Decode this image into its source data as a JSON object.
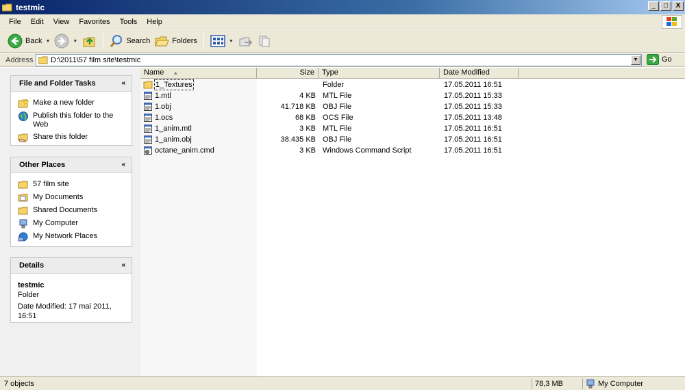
{
  "window": {
    "title": "testmic",
    "min": "_",
    "max": "□",
    "close": "X"
  },
  "menu": [
    "File",
    "Edit",
    "View",
    "Favorites",
    "Tools",
    "Help"
  ],
  "toolbar": {
    "back": "Back",
    "search": "Search",
    "folders": "Folders"
  },
  "address": {
    "label": "Address",
    "path": "D:\\2011\\57 film site\\testmic",
    "go": "Go"
  },
  "tasks": {
    "title": "File and Folder Tasks",
    "items": [
      "Make a new folder",
      "Publish this folder to the Web",
      "Share this folder"
    ]
  },
  "other_places": {
    "title": "Other Places",
    "items": [
      "57 film site",
      "My Documents",
      "Shared Documents",
      "My Computer",
      "My Network Places"
    ]
  },
  "details": {
    "title": "Details",
    "name": "testmic",
    "kind": "Folder",
    "modified": "Date Modified: 17 mai 2011, 16:51"
  },
  "columns": {
    "name": "Name",
    "sort": "▲",
    "size": "Size",
    "type": "Type",
    "date": "Date Modified"
  },
  "files": [
    {
      "name": "1_Textures",
      "size": "",
      "type": "Folder",
      "date": "17.05.2011 16:51",
      "icon": "folder-icon"
    },
    {
      "name": "1.mtl",
      "size": "4 KB",
      "type": "MTL File",
      "date": "17.05.2011 15:33",
      "icon": "file-icon"
    },
    {
      "name": "1.obj",
      "size": "41.718 KB",
      "type": "OBJ File",
      "date": "17.05.2011 15:33",
      "icon": "file-icon"
    },
    {
      "name": "1.ocs",
      "size": "68 KB",
      "type": "OCS File",
      "date": "17.05.2011 13:48",
      "icon": "file-icon"
    },
    {
      "name": "1_anim.mtl",
      "size": "3 KB",
      "type": "MTL File",
      "date": "17.05.2011 16:51",
      "icon": "file-icon"
    },
    {
      "name": "1_anim.obj",
      "size": "38.435 KB",
      "type": "OBJ File",
      "date": "17.05.2011 16:51",
      "icon": "file-icon"
    },
    {
      "name": "octane_anim.cmd",
      "size": "3 KB",
      "type": "Windows Command Script",
      "date": "17.05.2011 16:51",
      "icon": "cmd-icon"
    }
  ],
  "status": {
    "count": "7 objects",
    "size": "78,3 MB",
    "zone": "My Computer"
  }
}
